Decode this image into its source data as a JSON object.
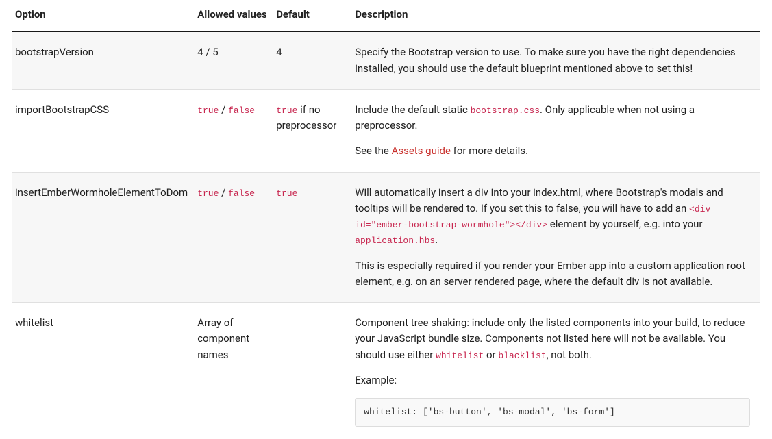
{
  "headers": {
    "option": "Option",
    "allowed": "Allowed values",
    "default": "Default",
    "description": "Description"
  },
  "rows": [
    {
      "option": "bootstrapVersion",
      "allowed_plain": "4 / 5",
      "default_plain": "4",
      "desc1": "Specify the Bootstrap version to use. To make sure you have the right dependencies installed, you should use the default blueprint mentioned above to set this!"
    },
    {
      "option": "importBootstrapCSS",
      "allowed_code1": "true",
      "allowed_sep": " / ",
      "allowed_code2": "false",
      "default_code": "true",
      "default_suffix": " if no preprocessor",
      "desc1_pre": "Include the default static ",
      "desc1_code": "bootstrap.css",
      "desc1_post": ". Only applicable when not using a preprocessor.",
      "desc2_pre": "See the ",
      "desc2_link": "Assets guide",
      "desc2_post": " for more details."
    },
    {
      "option": "insertEmberWormholeElementToDom",
      "allowed_code1": "true",
      "allowed_sep": " / ",
      "allowed_code2": "false",
      "default_code": "true",
      "desc1_pre": "Will automatically insert a div into your index.html, where Bootstrap's modals and tooltips will be rendered to. If you set this to false, you will have to add an ",
      "desc1_code1": "<div id=\"ember-bootstrap-wormhole\"></div>",
      "desc1_mid": " element by yourself, e.g. into your ",
      "desc1_code2": "application.hbs",
      "desc1_post": ".",
      "desc2": "This is especially required if you render your Ember app into a custom application root element, e.g. on an server rendered page, where the default div is not available."
    },
    {
      "option": "whitelist",
      "allowed_plain": "Array of component names",
      "desc1_pre": "Component tree shaking: include only the listed components into your build, to reduce your JavaScript bundle size. Components not listed here will not be available. You should use either ",
      "desc1_code1": "whitelist",
      "desc1_mid": " or ",
      "desc1_code2": "blacklist",
      "desc1_post": ", not both.",
      "desc2": "Example:",
      "example": "whitelist: ['bs-button', 'bs-modal', 'bs-form']"
    }
  ]
}
